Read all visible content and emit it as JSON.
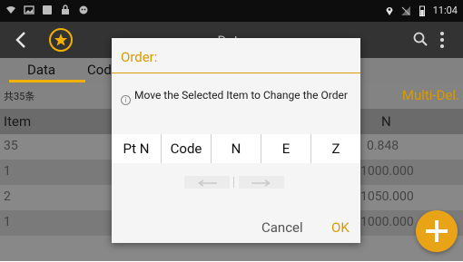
{
  "status_bar": {
    "time": "11:04",
    "left_icons": [
      "wifi-off-icon",
      "image-icon",
      "square-icon",
      "lock-icon",
      "robot-icon"
    ],
    "right_icons": [
      "location-icon",
      "signal-off-icon",
      "battery-icon"
    ]
  },
  "app_bar": {
    "title": "Data"
  },
  "tabs": {
    "data": "Data",
    "code": "Cod"
  },
  "list": {
    "count": "共35条",
    "multi_delete": "Multi-Del."
  },
  "table": {
    "headers": {
      "item": "Item",
      "n": "N"
    },
    "rows": [
      {
        "item": "35",
        "n": "0.848"
      },
      {
        "item": "1",
        "n": "1000.000"
      },
      {
        "item": "2",
        "n": "1050.000"
      },
      {
        "item": "1",
        "n": "1000.000"
      }
    ]
  },
  "dialog": {
    "title": "Order:",
    "info": "Move the Selected Item to Change the Order",
    "columns": [
      "Pt N",
      "Code",
      "N",
      "E",
      "Z"
    ],
    "cancel": "Cancel",
    "ok": "OK"
  },
  "colors": {
    "accent": "#d99a00",
    "fab": "#e8a317",
    "title_bar": "#333333"
  }
}
